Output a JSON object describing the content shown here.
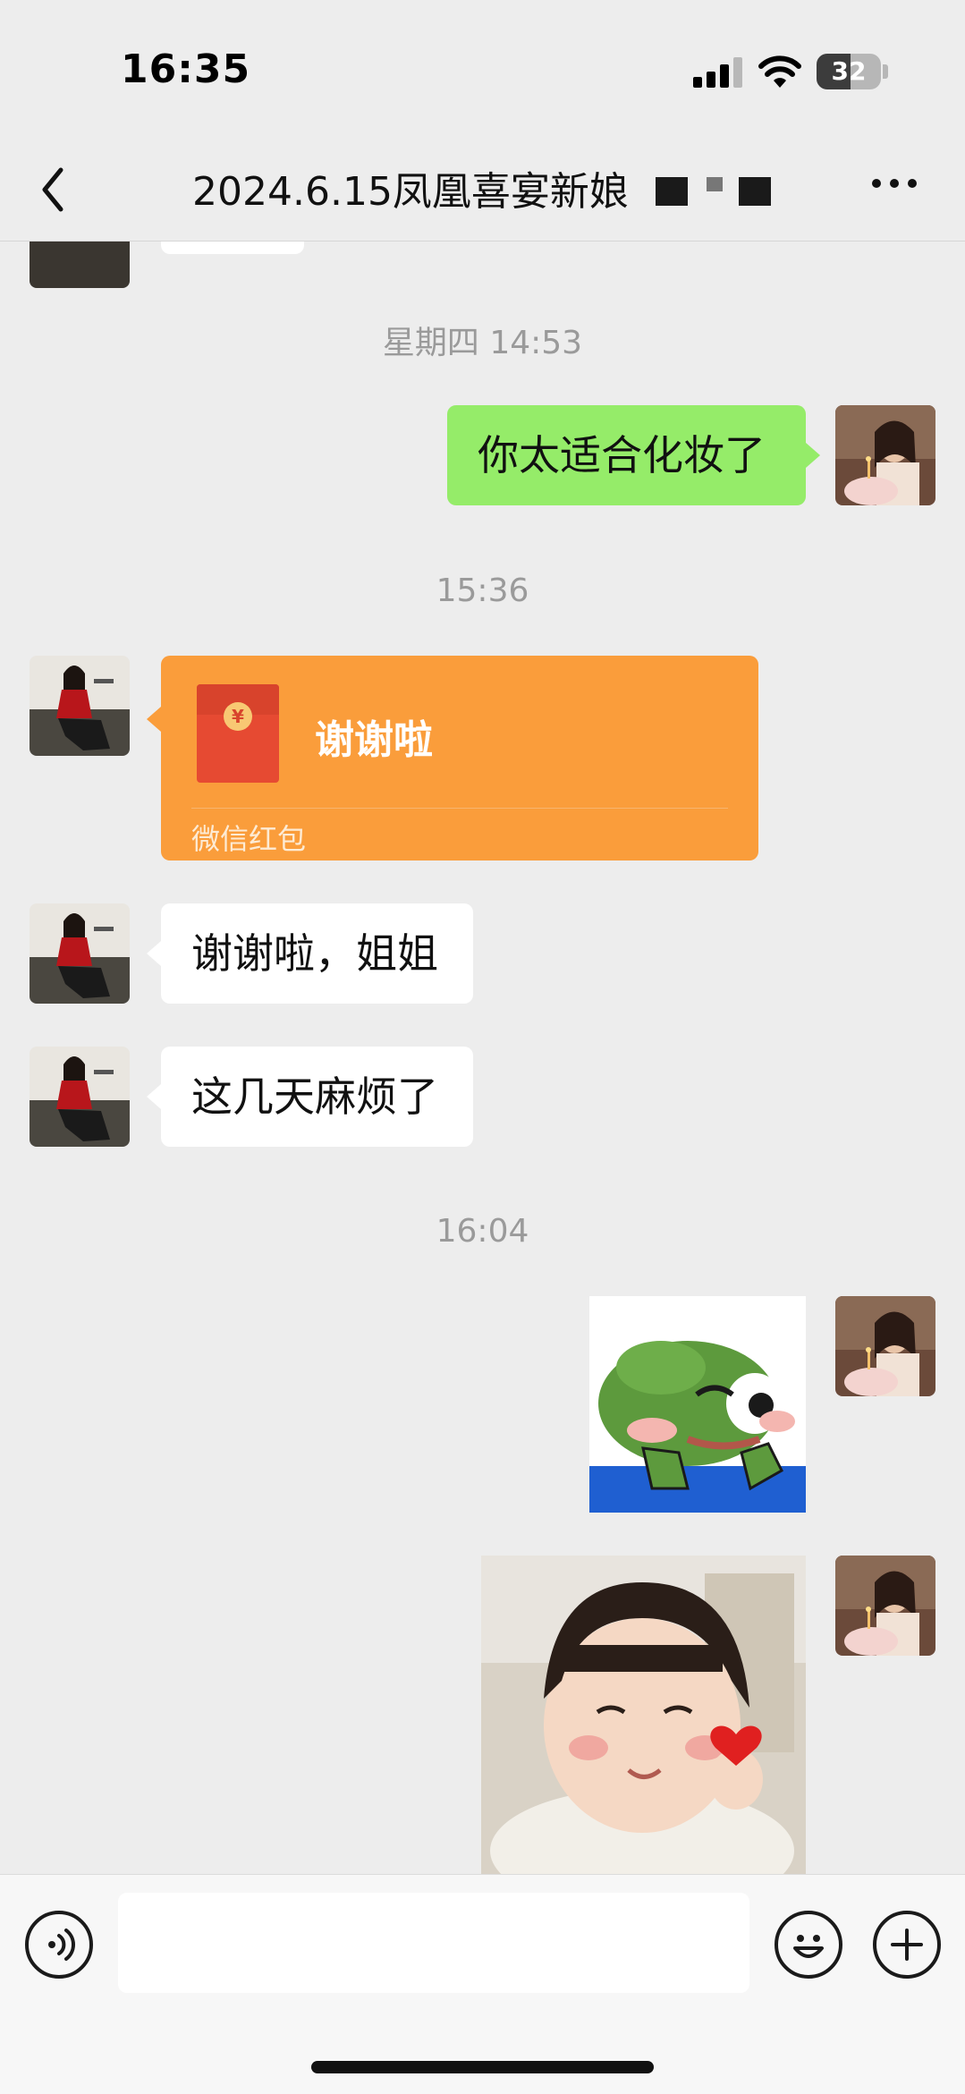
{
  "status_bar": {
    "time": "16:35",
    "battery": "32"
  },
  "nav": {
    "title": "2024.6.15凤凰喜宴新娘"
  },
  "messages": {
    "time_1": "星期四 14:53",
    "sent_1": "你太适合化妆了",
    "time_2": "15:36",
    "red_packet": {
      "label": "谢谢啦",
      "footer": "微信红包",
      "coin": "¥"
    },
    "recv_1": "谢谢啦，姐姐",
    "recv_2": "这几天麻烦了",
    "time_3": "16:04"
  },
  "colors": {
    "sent_bubble": "#95ec69",
    "received_bubble": "#ffffff",
    "red_packet": "#fa9d3b",
    "background": "#ededed"
  },
  "icons": [
    "back-icon",
    "more-icon",
    "voice-icon",
    "emoji-icon",
    "plus-icon"
  ]
}
